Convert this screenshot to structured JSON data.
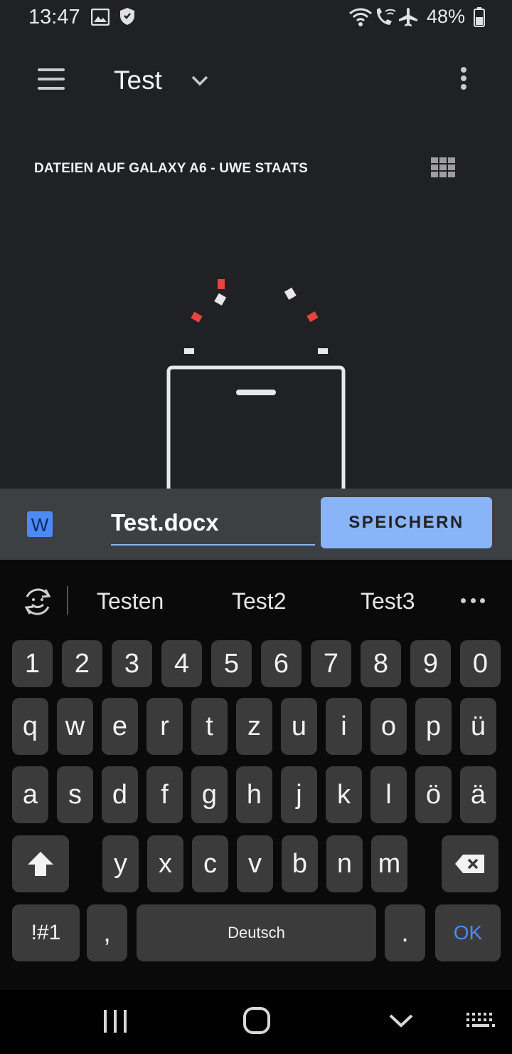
{
  "status_bar": {
    "time": "13:47",
    "battery": "48%",
    "icons": [
      "image-icon",
      "shield-icon",
      "wifi-icon",
      "wifi-call-icon",
      "airplane-icon",
      "battery-icon"
    ]
  },
  "toolbar": {
    "title": "Test",
    "icons": [
      "menu-icon",
      "chevron-down-icon",
      "more-vert-icon"
    ]
  },
  "section": {
    "header": "DATEIEN AUF GALAXY A6 - UWE STAATS",
    "view_icon": "grid-view-icon"
  },
  "save_bar": {
    "app_icon_letter": "W",
    "filename": "Test.docx",
    "save_label": "SPEICHERN"
  },
  "keyboard": {
    "suggestions": [
      "Testen",
      "Test2",
      "Test3"
    ],
    "rows": [
      [
        "1",
        "2",
        "3",
        "4",
        "5",
        "6",
        "7",
        "8",
        "9",
        "0"
      ],
      [
        "q",
        "w",
        "e",
        "r",
        "t",
        "z",
        "u",
        "i",
        "o",
        "p",
        "ü"
      ],
      [
        "a",
        "s",
        "d",
        "f",
        "g",
        "h",
        "j",
        "k",
        "l",
        "ö",
        "ä"
      ],
      [
        "y",
        "x",
        "c",
        "v",
        "b",
        "n",
        "m"
      ]
    ],
    "symbols_label": "!#1",
    "comma": ",",
    "space_label": "Deutsch",
    "period": ".",
    "ok_label": "OK"
  },
  "colors": {
    "app_background": "#202124",
    "save_bar": "#3c4043",
    "accent": "#8ab4f8",
    "word_blue": "#4c8bf5",
    "illustration_red": "#e8453c",
    "key": "#3b3b3b"
  }
}
